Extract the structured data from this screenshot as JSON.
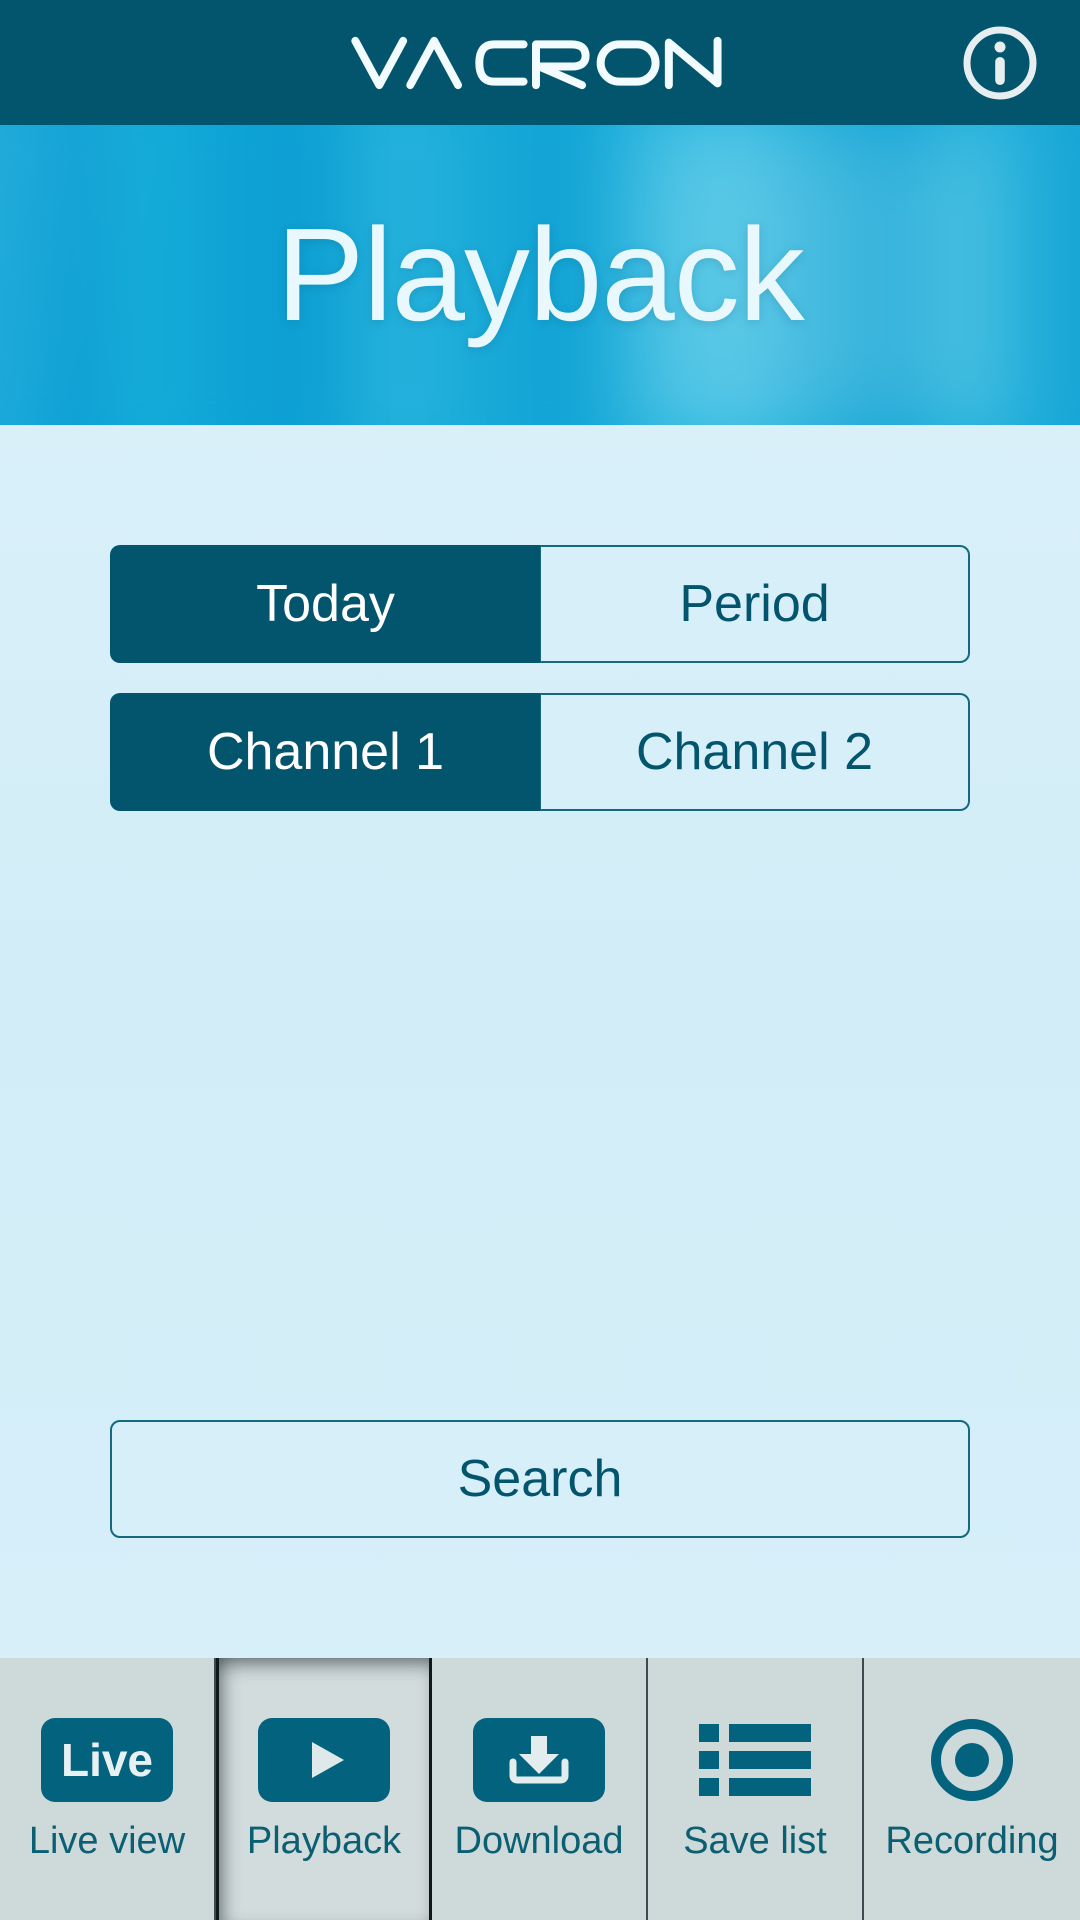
{
  "header": {
    "brand": "VACRON",
    "info_icon": "info-circle-icon"
  },
  "banner": {
    "title": "Playback"
  },
  "colors": {
    "brand_dark": "#03556e",
    "banner_cyan": "#0da6d8",
    "page_background": "#d3eef8",
    "navbar_background": "#ced9da",
    "accent_text": "#0b5f72"
  },
  "main": {
    "range_toggle": {
      "name": "date-range-toggle",
      "options": [
        {
          "label": "Today",
          "selected": true
        },
        {
          "label": "Period",
          "selected": false
        }
      ]
    },
    "channel_toggle": {
      "name": "channel-toggle",
      "options": [
        {
          "label": "Channel 1",
          "selected": true
        },
        {
          "label": "Channel 2",
          "selected": false
        }
      ]
    },
    "search_button": {
      "label": "Search"
    }
  },
  "navbar": {
    "items": [
      {
        "label": "Live view",
        "icon": "live-chip-icon",
        "active": false
      },
      {
        "label": "Playback",
        "icon": "play-icon",
        "active": true
      },
      {
        "label": "Download",
        "icon": "download-tray-icon",
        "active": false
      },
      {
        "label": "Save list",
        "icon": "list-icon",
        "active": false
      },
      {
        "label": "Recording",
        "icon": "record-dot-icon",
        "active": false
      }
    ],
    "live_chip_text": "Live"
  }
}
